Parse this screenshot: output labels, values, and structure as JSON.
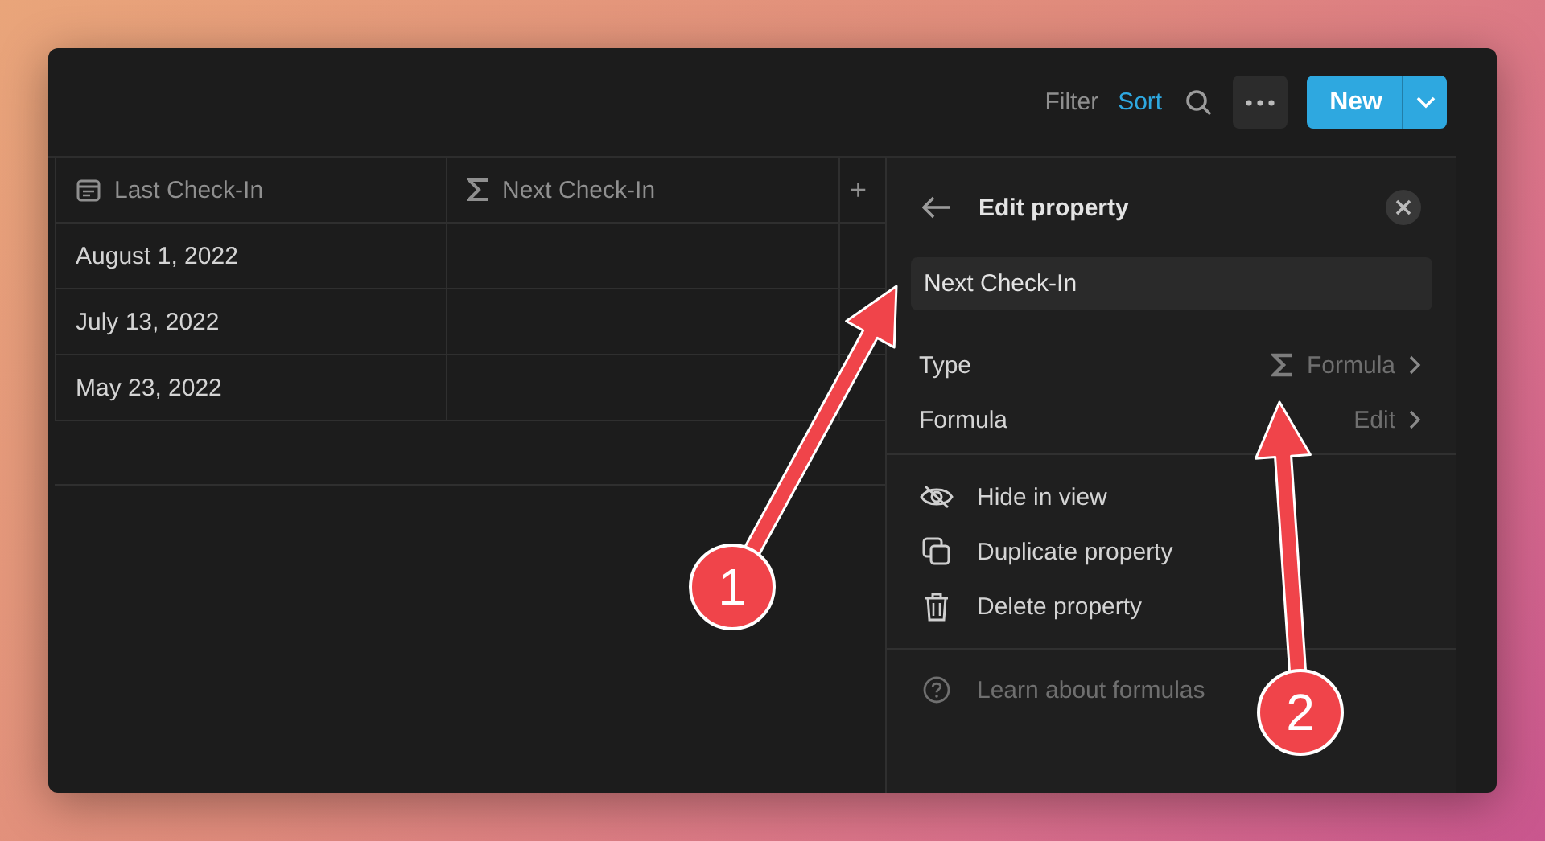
{
  "toolbar": {
    "filter": "Filter",
    "sort": "Sort",
    "new_button": "New"
  },
  "table": {
    "columns": [
      {
        "label": "Last Check-In",
        "kind": "date"
      },
      {
        "label": "Next Check-In",
        "kind": "formula"
      }
    ],
    "add_column": "+",
    "rows": [
      {
        "last_check_in": "August 1, 2022"
      },
      {
        "last_check_in": "July 13, 2022"
      },
      {
        "last_check_in": "May 23, 2022"
      }
    ]
  },
  "panel": {
    "title": "Edit property",
    "name_value": "Next Check-In",
    "properties": [
      {
        "label": "Type",
        "value": "Formula",
        "kind": "type"
      },
      {
        "label": "Formula",
        "value": "Edit",
        "kind": "plain"
      }
    ],
    "actions": [
      {
        "label": "Hide in view",
        "kind": "hide"
      },
      {
        "label": "Duplicate property",
        "kind": "duplicate"
      },
      {
        "label": "Delete property",
        "kind": "delete"
      }
    ],
    "help": "Learn about formulas"
  },
  "annotations": [
    {
      "label": "1"
    },
    {
      "label": "2"
    }
  ]
}
